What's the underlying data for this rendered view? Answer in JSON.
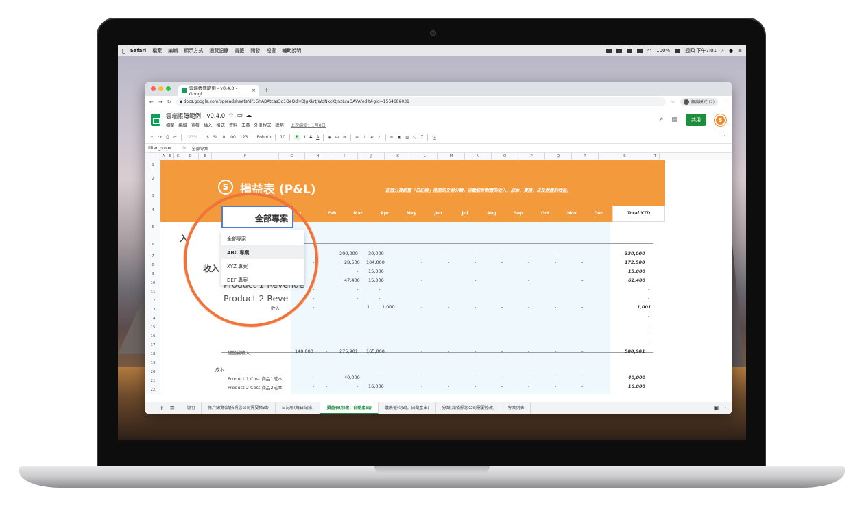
{
  "menubar": {
    "apple": "",
    "app": "Safari",
    "items": [
      "檔案",
      "編輯",
      "顯示方式",
      "瀏覽記錄",
      "書籤",
      "開發",
      "視窗",
      "輔助說明"
    ],
    "battery": "100%",
    "clock": "週四 下午7:01"
  },
  "browser": {
    "tab_title": "雲端帳簿範例 - v0.4.0 - Googl",
    "url": "docs.google.com/spreadsheets/d/1GhABAtcas3q1QeQdlvDJgKkrtjWqNxcKtjnzLcaQAVA/edit#gid=1564686031",
    "profile": "無痕模式 (2)"
  },
  "sheet": {
    "title": "雲端帳簿範例 - v0.4.0",
    "menus": [
      "檔案",
      "編輯",
      "查看",
      "插入",
      "格式",
      "資料",
      "工具",
      "外掛程式",
      "說明"
    ],
    "last_edit": "上次編輯：1月8日",
    "share": "共用",
    "toolbar": {
      "zoom": "123%",
      "currency": "$",
      "percent": "%",
      "dec0": ".0",
      "dec00": ".00",
      "num": "123",
      "font": "Roboto",
      "size": "10",
      "bold": "B",
      "italic": "I",
      "strike": "S",
      "textcolor": "A"
    },
    "namebox": "filter_projec",
    "formula_value": "全部專案",
    "columns": [
      "A",
      "B",
      "C",
      "D",
      "E",
      "F",
      "G",
      "H",
      "I",
      "J",
      "K",
      "L",
      "M",
      "N",
      "O",
      "P",
      "Q",
      "R",
      "S",
      "T"
    ],
    "rows": [
      "1",
      "2",
      "3",
      "4",
      "5",
      "6",
      "7",
      "8",
      "9",
      "10",
      "11",
      "12",
      "13",
      "14",
      "15",
      "16",
      "17",
      "18",
      "19",
      "20",
      "21",
      "22"
    ]
  },
  "banner": {
    "logo": "S",
    "title": "損益表 (P&L)",
    "note": "這個分頁統整「日記帳」裡面的交易分類，自動統計對應的收入、成本、費用，以及對應的收益。"
  },
  "months": [
    "Feb",
    "Mar",
    "Apr",
    "May",
    "Jun",
    "Jul",
    "Aug",
    "Sep",
    "Oct",
    "Nov",
    "Dec"
  ],
  "month_partial": "n",
  "ytd_header": "Total YTD",
  "filter": {
    "value": "全部專案",
    "options": [
      "全部專案",
      "ABC 專案",
      "XYZ 專案",
      "DEF 專案"
    ],
    "selected_index": 1
  },
  "labels": {
    "income_big": "收入",
    "income_left": "入",
    "p1_revenue": "Product 1 Revenue",
    "p2_revenue": "Product 2 Reve",
    "row13_tail": "收入",
    "total_sales": "總銷貨收入",
    "cost": "成本",
    "p1_cost": "Product 1 Cost 商品1成本",
    "p2_cost": "Product 2 Cost 商品2成本"
  },
  "rows_data": {
    "r7": {
      "mar": "200,000",
      "apr": "30,000",
      "ytd": "330,000"
    },
    "r8": {
      "mar": "28,500",
      "apr": "104,000",
      "ytd": "172,500"
    },
    "r9": {
      "apr": "15,000",
      "ytd": "15,000"
    },
    "r10": {
      "mar": "47,400",
      "apr": "15,000",
      "ytd": "62,400"
    },
    "r13": {
      "mar": "1",
      "apr": "1,000",
      "ytd": "1,001"
    },
    "r18": {
      "jan": "140,000",
      "mar": "275,901",
      "apr": "165,000",
      "ytd": "580,901"
    },
    "r22a": {
      "mar": "40,000",
      "ytd": "40,000"
    },
    "r22b": {
      "apr": "16,000",
      "ytd": "16,000"
    },
    "dash": "-"
  },
  "sheet_tabs": [
    "說明",
    "帳戶總覽(請依照您公司需要修改)",
    "日記帳(每日記錄)",
    "損益表(勿改，自動產出)",
    "儀表板(勿改，自動產出)",
    "分類(請依照您公司需要修改)",
    "專案列表"
  ],
  "active_tab_index": 3,
  "colors": {
    "brand_orange": "#f39a3d",
    "highlight_ring": "#f0743a",
    "sheets_green": "#0f9d58",
    "share_green": "#1e8e3e",
    "selection_blue": "#4a7ddb"
  }
}
